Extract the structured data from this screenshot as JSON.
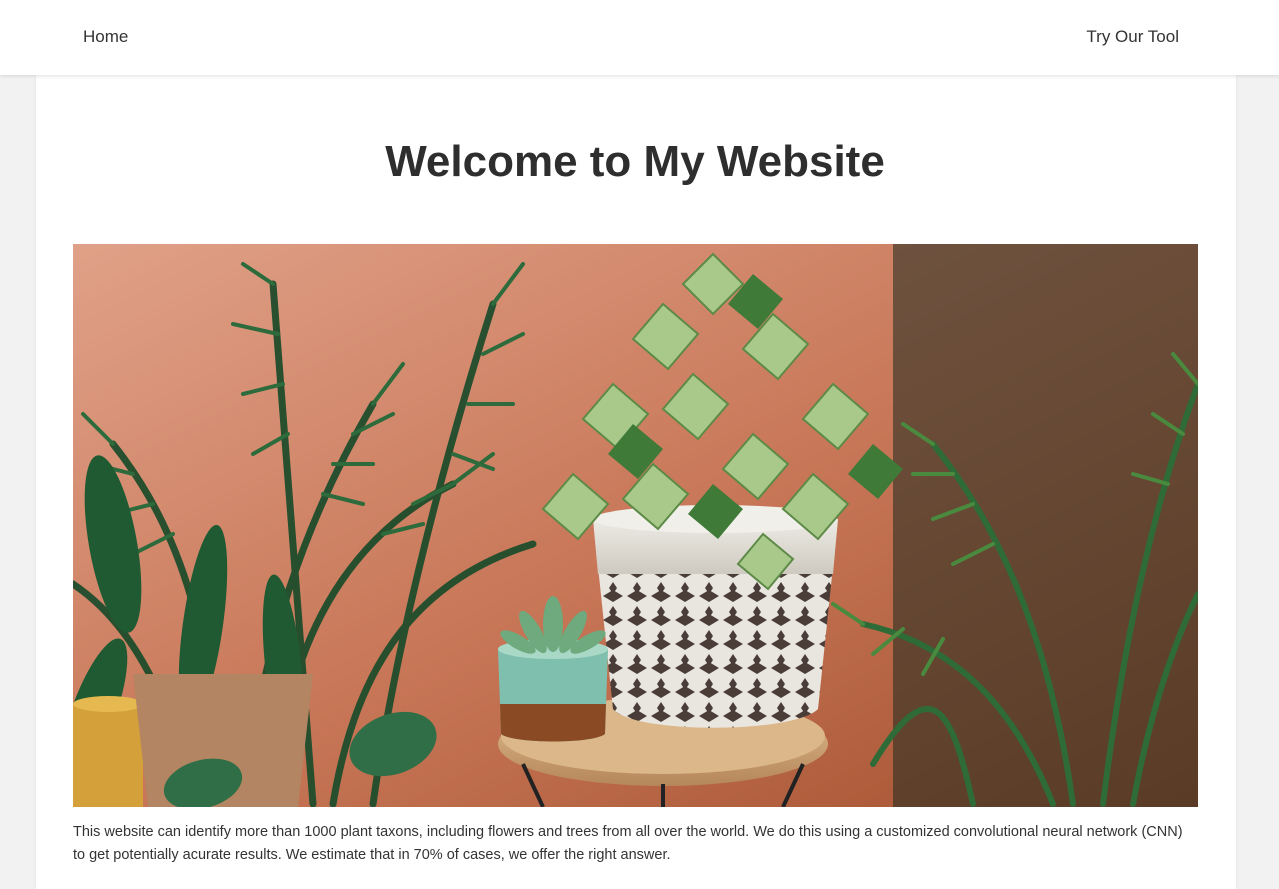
{
  "nav": {
    "home_label": "Home",
    "tool_label": "Try Our Tool"
  },
  "main": {
    "title": "Welcome to My Website",
    "hero_image": "photo of potted house plants in front of a terracotta wall",
    "description": "This website can identify more than 1000 plant taxons, including flowers and trees from all over the world. We do this using a customized convolutional neural network (CNN) to get potentially acurate results. We estimate that in 70% of cases, we offer the right answer."
  },
  "colors": {
    "background": "#f2f2f2",
    "card": "#ffffff",
    "text": "#333333",
    "wall": "#c8806a"
  }
}
